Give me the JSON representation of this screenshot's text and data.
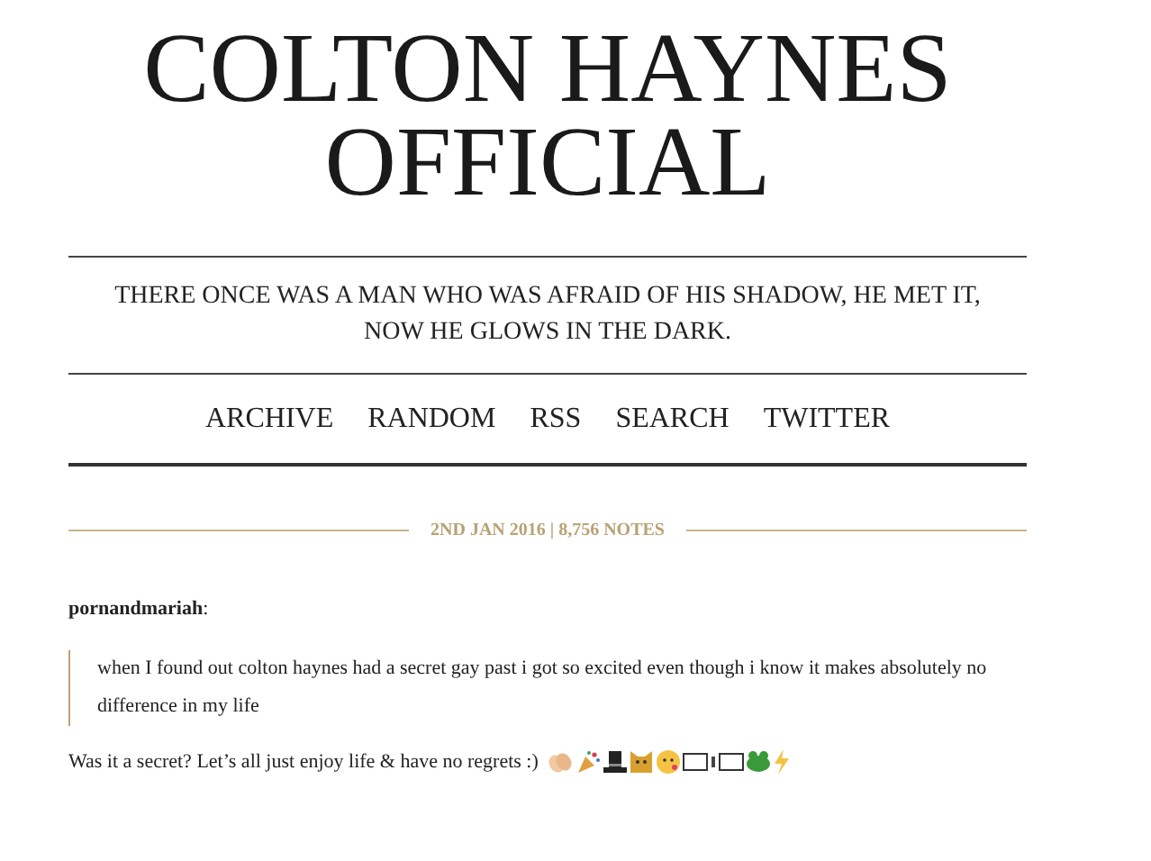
{
  "blog_title": "COLTON HAYNES OFFICIAL",
  "description": "THERE ONCE WAS A MAN WHO WAS AFRAID OF HIS SHADOW, HE MET IT, NOW HE GLOWS IN THE DARK.",
  "nav": [
    "ARCHIVE",
    "RANDOM",
    "RSS",
    "SEARCH",
    "TWITTER"
  ],
  "post": {
    "meta": "2ND JAN 2016 | 8,756 NOTES",
    "source_user": "pornandmariah",
    "source_colon": ":",
    "quote": "when I found out colton haynes had a secret gay past i got so excited even though i know it makes absolutely no difference in my life",
    "reply": "Was it a secret? Let’s all just enjoy life & have no regrets :)"
  }
}
